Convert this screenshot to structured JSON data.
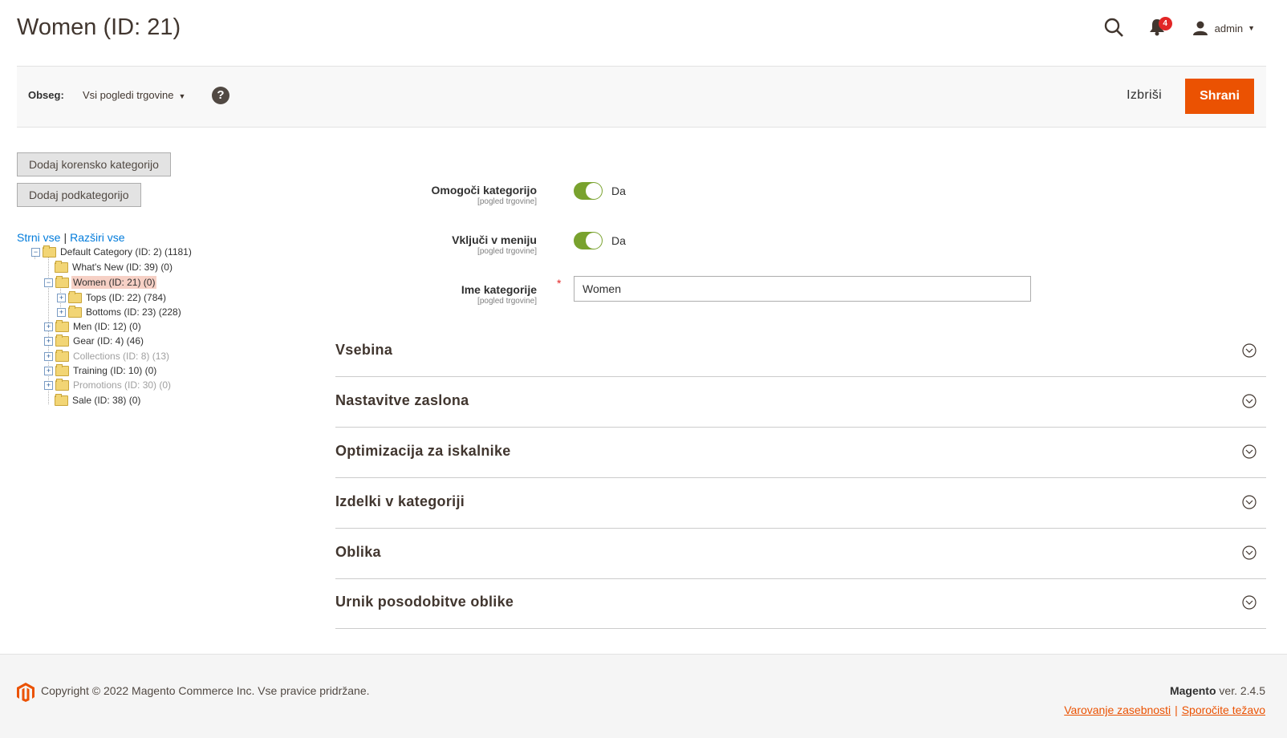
{
  "page": {
    "title": "Women (ID: 21)"
  },
  "header": {
    "notifications_count": "4",
    "user": "admin"
  },
  "toolbar": {
    "scope_label": "Obseg:",
    "scope_value": "Vsi pogledi trgovine",
    "delete_label": "Izbriši",
    "save_label": "Shrani"
  },
  "tree": {
    "add_root_label": "Dodaj korensko kategorijo",
    "add_sub_label": "Dodaj podkategorijo",
    "collapse_all": "Strni vse",
    "expand_all": "Razširi vse",
    "nodes": [
      {
        "label": "Default Category (ID: 2) (1181)"
      },
      {
        "label": "What's New (ID: 39) (0)"
      },
      {
        "label": "Women (ID: 21) (0)"
      },
      {
        "label": "Tops (ID: 22) (784)"
      },
      {
        "label": "Bottoms (ID: 23) (228)"
      },
      {
        "label": "Men (ID: 12) (0)"
      },
      {
        "label": "Gear (ID: 4) (46)"
      },
      {
        "label": "Collections (ID: 8) (13)"
      },
      {
        "label": "Training (ID: 10) (0)"
      },
      {
        "label": "Promotions (ID: 30) (0)"
      },
      {
        "label": "Sale (ID: 38) (0)"
      }
    ]
  },
  "form": {
    "enable_label": "Omogoči kategorijo",
    "enable_scope": "[pogled trgovine]",
    "enable_value": "Da",
    "menu_label": "Vključi v meniju",
    "menu_scope": "[pogled trgovine]",
    "menu_value": "Da",
    "name_label": "Ime kategorije",
    "name_scope": "[pogled trgovine]",
    "name_value": "Women"
  },
  "sections": [
    {
      "title": "Vsebina"
    },
    {
      "title": "Nastavitve zaslona"
    },
    {
      "title": "Optimizacija za iskalnike"
    },
    {
      "title": "Izdelki v kategoriji"
    },
    {
      "title": "Oblika"
    },
    {
      "title": "Urnik posodobitve oblike"
    }
  ],
  "footer": {
    "copyright": "Copyright © 2022 Magento Commerce Inc. Vse pravice pridržane.",
    "brand": "Magento",
    "version": "ver. 2.4.5",
    "privacy_link": "Varovanje zasebnosti",
    "report_link": "Sporočite težavo"
  },
  "colors": {
    "accent": "#eb5202",
    "toggle_on": "#79a22e",
    "link": "#007bdb"
  }
}
